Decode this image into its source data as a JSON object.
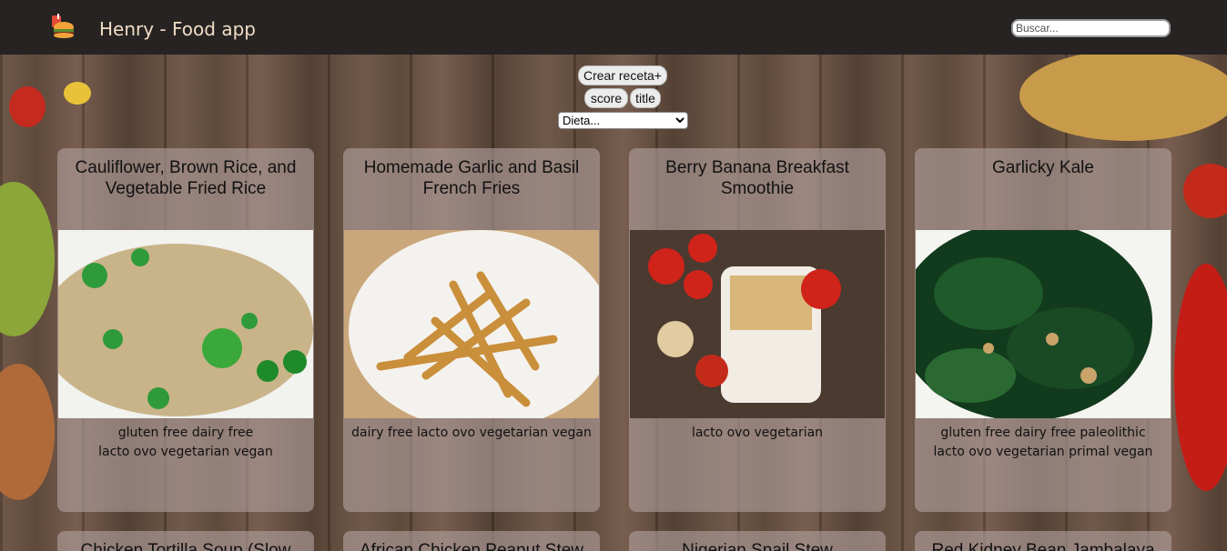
{
  "app": {
    "title": "Henry - Food app"
  },
  "search": {
    "placeholder": "Buscar..."
  },
  "controls": {
    "create_label": "Crear receta+",
    "score_label": "score",
    "title_label": "title",
    "diet_selected": "Dieta..."
  },
  "recipes": [
    {
      "title": "Cauliflower, Brown Rice, and Vegetable Fried Rice",
      "diets_line1": "gluten free  dairy free",
      "diets_line2": "lacto ovo vegetarian  vegan"
    },
    {
      "title": "Homemade Garlic and Basil French Fries",
      "diets_line1": "dairy free  lacto ovo vegetarian  vegan",
      "diets_line2": ""
    },
    {
      "title": "Berry Banana Breakfast Smoothie",
      "diets_line1": "lacto ovo vegetarian",
      "diets_line2": ""
    },
    {
      "title": "Garlicky Kale",
      "diets_line1": "gluten free  dairy free  paleolithic",
      "diets_line2": "lacto ovo vegetarian  primal  vegan"
    },
    {
      "title": "Chicken Tortilla Soup (Slow",
      "diets_line1": "",
      "diets_line2": ""
    },
    {
      "title": "African Chicken Peanut Stew",
      "diets_line1": "",
      "diets_line2": ""
    },
    {
      "title": "Nigerian Snail Stew",
      "diets_line1": "",
      "diets_line2": ""
    },
    {
      "title": "Red Kidney Bean Jambalaya",
      "diets_line1": "",
      "diets_line2": ""
    }
  ],
  "colors": {
    "navbar": "#262322",
    "card": "#b2a09e",
    "accent": "#f1dcc5"
  }
}
